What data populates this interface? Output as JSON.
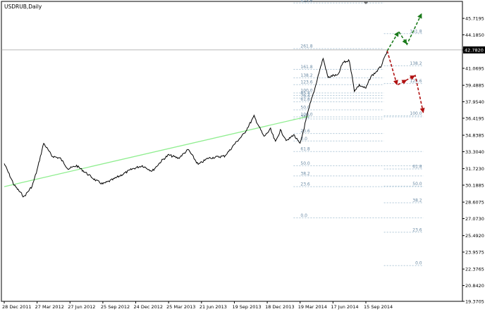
{
  "chart_data": {
    "type": "line",
    "title": "USDRUB,Daily",
    "xlabel": "",
    "ylabel": "",
    "ylim": [
      19.3705,
      47.3
    ]
  },
  "x_axis": {
    "tick_labels": [
      "28 Dec 2011",
      "27 Mar 2012",
      "27 Jun 2012",
      "25 Sep 2012",
      "24 Dec 2012",
      "25 Mar 2013",
      "21 Jun 2013",
      "19 Sep 2013",
      "18 Dec 2013",
      "19 Mar 2014",
      "17 Jun 2014",
      "15 Sep 2014"
    ],
    "tick_index": [
      0,
      1,
      2,
      3,
      4,
      5,
      6,
      7,
      8,
      9,
      10,
      11
    ]
  },
  "y_axis": {
    "tick_values": [
      45.7195,
      44.185,
      42.782,
      41.0695,
      39.4885,
      37.954,
      36.4195,
      34.8385,
      33.304,
      31.723,
      30.1885,
      28.6075,
      27.073,
      25.492,
      23.9575,
      22.3765,
      20.842,
      19.3705
    ],
    "tick_labels": [
      "45.7195",
      "44.1850",
      "42.7820",
      "41.0695",
      "39.4885",
      "37.9540",
      "36.4195",
      "34.8385",
      "33.3040",
      "31.7230",
      "30.1885",
      "28.6075",
      "27.0730",
      "25.4920",
      "23.9575",
      "22.3765",
      "20.8420",
      "19.3705"
    ],
    "current_price": "42.7820",
    "current_value": 42.782
  },
  "price_series": {
    "x": [
      0,
      0.3,
      0.6,
      0.85,
      1.0,
      1.2,
      1.45,
      1.7,
      1.95,
      2.2,
      2.5,
      2.8,
      3.0,
      3.3,
      3.6,
      3.9,
      4.2,
      4.5,
      4.8,
      5.0,
      5.3,
      5.6,
      5.9,
      6.2,
      6.45,
      6.7,
      6.85,
      7.0,
      7.3,
      7.6,
      7.9,
      8.1,
      8.25,
      8.4,
      8.6,
      8.8,
      9.0,
      9.15,
      9.3,
      9.45,
      9.55,
      9.7,
      9.85,
      10.0,
      10.15,
      10.3,
      10.5,
      10.65,
      10.8,
      11.0,
      11.15,
      11.3,
      11.45,
      11.55,
      11.65
    ],
    "y": [
      32.2,
      30.2,
      29.1,
      30.1,
      31.6,
      34.1,
      32.9,
      32.7,
      31.7,
      32.0,
      31.3,
      30.6,
      30.3,
      30.7,
      31.2,
      31.7,
      32.0,
      31.5,
      32.5,
      33.0,
      32.7,
      33.5,
      32.1,
      32.7,
      32.8,
      32.9,
      33.4,
      34.0,
      35.0,
      36.6,
      34.7,
      35.4,
      34.2,
      35.3,
      34.3,
      34.9,
      34.0,
      35.9,
      37.7,
      39.2,
      40.4,
      42.0,
      40.2,
      40.4,
      40.4,
      41.6,
      41.8,
      39.0,
      39.5,
      39.2,
      40.3,
      40.7,
      41.2,
      41.9,
      42.7
    ]
  },
  "fib_upper": {
    "levels": [
      {
        "label": "423.6",
        "value": 47.15
      },
      {
        "label": "261.8",
        "value": 42.9
      },
      {
        "label": "161.8",
        "value": 40.97
      },
      {
        "label": "138.2",
        "value": 40.18
      },
      {
        "label": "123.6",
        "value": 39.55
      },
      {
        "label": "100.0",
        "value": 38.78
      },
      {
        "label": "85.4",
        "value": 38.55
      },
      {
        "label": "76.4",
        "value": 38.3
      },
      {
        "label": "61.8",
        "value": 37.95
      },
      {
        "label": "50.0",
        "value": 37.2
      },
      {
        "label": "38.2",
        "value": 36.35
      },
      {
        "label": "23.6",
        "value": 35.0
      },
      {
        "label": "0.0",
        "value": 34.3
      }
    ],
    "x_start": 8.8,
    "x_end": 11.55
  },
  "fib_lower": {
    "levels": [
      {
        "label": "100.0",
        "value": 36.55
      },
      {
        "label": "61.8",
        "value": 33.32
      },
      {
        "label": "50.0",
        "value": 32.0
      },
      {
        "label": "38.2",
        "value": 31.05
      },
      {
        "label": "23.6",
        "value": 30.05
      },
      {
        "label": "0.0",
        "value": 27.15
      }
    ],
    "x_start": 8.8,
    "x_end": 12.75
  },
  "fib_right": {
    "levels": [
      {
        "label": "161.8",
        "value": 44.3
      },
      {
        "label": "138.2",
        "value": 41.3
      },
      {
        "label": "123.6",
        "value": 39.65
      },
      {
        "label": "100.0",
        "value": 36.65
      },
      {
        "label": "61.8",
        "value": 31.7
      },
      {
        "label": "50.0",
        "value": 30.1
      },
      {
        "label": "38.2",
        "value": 28.55
      },
      {
        "label": "23.6",
        "value": 25.8
      },
      {
        "label": "0.0",
        "value": 22.7
      }
    ],
    "x_start": 11.55,
    "x_end": 12.75
  },
  "trendline": {
    "x": [
      0,
      9.25
    ],
    "y": [
      30.05,
      36.6
    ],
    "color": "#90ee90"
  },
  "colors": {
    "price": "#000000",
    "fib": "#b0c8d8",
    "fib_text": "#6a8aa4",
    "bullish": "#1a7a1a",
    "bearish": "#b01010",
    "trendline": "#90ee90",
    "current_price_bg": "#000000"
  },
  "scenario_bull": {
    "x": [
      11.65,
      12.0,
      12.25,
      12.7
    ],
    "y": [
      42.7,
      44.5,
      43.3,
      46.2
    ]
  },
  "scenario_bear": {
    "x": [
      11.65,
      11.95,
      12.25,
      12.5,
      12.75
    ],
    "y": [
      42.7,
      39.5,
      40.0,
      40.4,
      36.9
    ]
  }
}
